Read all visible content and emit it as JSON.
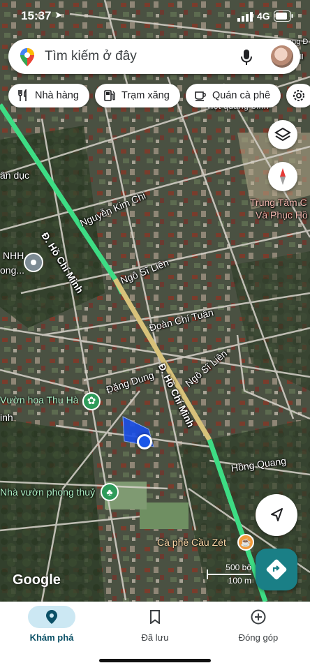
{
  "status_bar": {
    "time": "15:37",
    "network": "4G"
  },
  "search": {
    "placeholder": "Tìm kiếm ở đây"
  },
  "chips": [
    {
      "label": "Nhà hàng",
      "icon": "restaurant-icon"
    },
    {
      "label": "Trạm xăng",
      "icon": "gas-station-icon"
    },
    {
      "label": "Quán cà phê",
      "icon": "coffee-icon"
    }
  ],
  "map_labels": {
    "ho_chi_minh_1": "Đ. Hồ Chí Minh",
    "ho_chi_minh_2": "Đ. Hồ Chí Minh",
    "nguyen_kim_chi": "Nguyễn Kim Chi",
    "ngo_si_lien_1": "Ngô Sĩ Liên",
    "ngo_si_lien_2": "Ngô Sĩ Liên",
    "doan_chi_tuan": "Đoàn Chí Tuân",
    "dang_dung": "Đặng Dung",
    "hong_quang": "Hồng Quang",
    "an_duc": "ân dục",
    "nhh": "NHH",
    "ong": "ong...",
    "viet_quang_binh": "việt quảng bình",
    "trung_tam_1": "Trung Tâm C",
    "trung_tam_2": "Và Phục Hồ",
    "inh": "inh",
    "top_right": "ang Đ",
    "top_right_2": "Vill"
  },
  "pois": {
    "vuon_hoa": "Vườn hoa Thu Hà",
    "nha_vuon": "Nhà vườn phong thuỷ",
    "ca_phe": "Cà phê Cầu Zét"
  },
  "scale": {
    "top": "500 bộ",
    "bottom": "100 m"
  },
  "brand": {
    "logo": "Google"
  },
  "nav": [
    {
      "label": "Khám phá",
      "icon": "explore-pin-icon"
    },
    {
      "label": "Đã lưu",
      "icon": "bookmark-icon"
    },
    {
      "label": "Đóng góp",
      "icon": "add-circle-icon"
    }
  ],
  "colors": {
    "route_green": "#3ddc84",
    "route_yellow": "#d8c27a",
    "accent": "#1a73e8",
    "location_blue": "#1a57e8"
  }
}
